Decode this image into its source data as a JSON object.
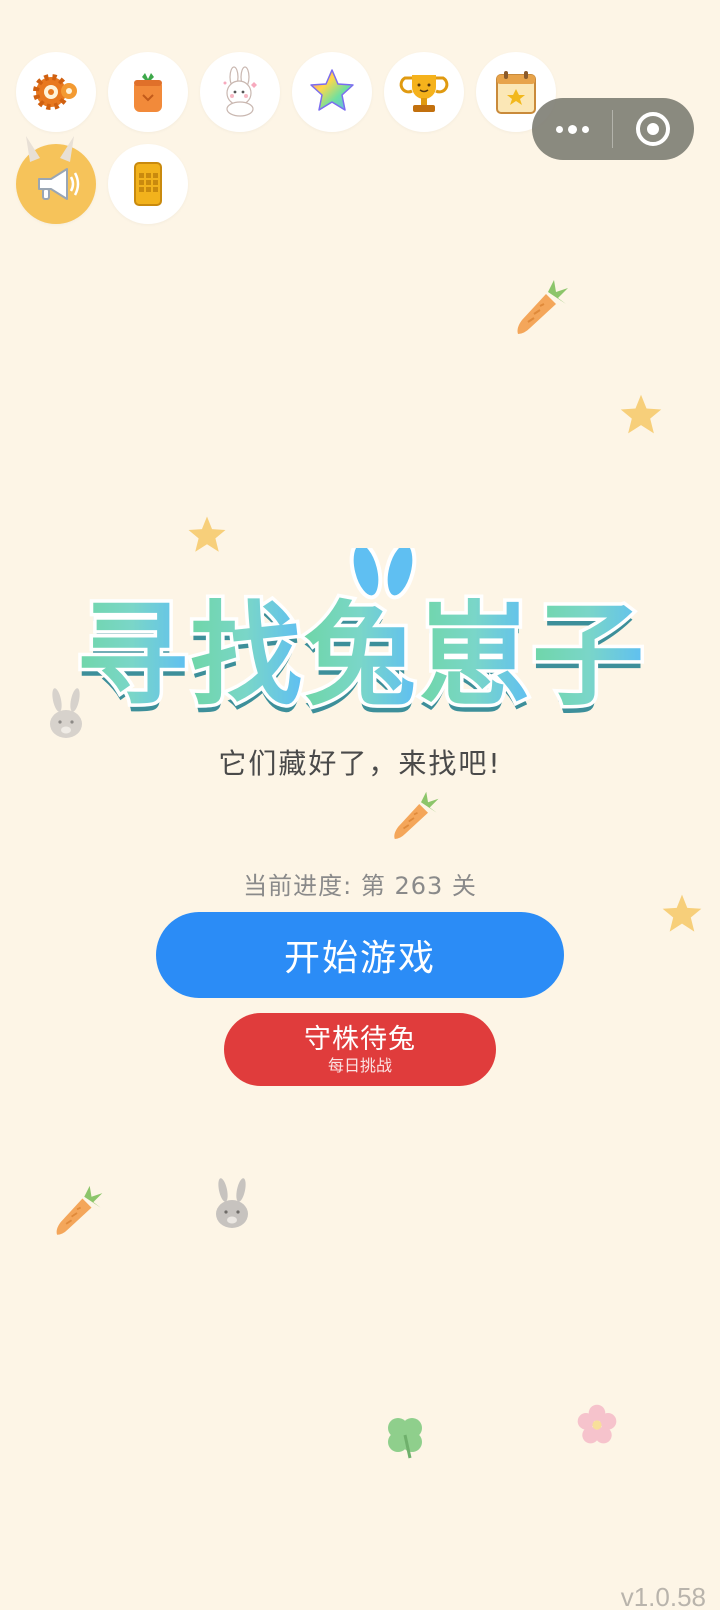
{
  "top_icons": [
    {
      "name": "settings-gear-icon"
    },
    {
      "name": "carrot-bag-icon"
    },
    {
      "name": "bunny-sticker-icon"
    },
    {
      "name": "rainbow-star-icon"
    },
    {
      "name": "trophy-icon"
    },
    {
      "name": "ranking-calendar-icon"
    },
    {
      "name": "megaphone-icon"
    },
    {
      "name": "gold-phone-icon"
    }
  ],
  "capsule": {
    "menu_icon": "more-dots-icon",
    "close_icon": "target-circle-icon"
  },
  "title": {
    "chars": [
      "寻",
      "找",
      "兔",
      "崽",
      "子"
    ]
  },
  "subtitle": "它们藏好了，来找吧!",
  "progress": {
    "text": "当前进度: 第 263 关"
  },
  "buttons": {
    "start_label": "开始游戏",
    "daily_label": "守株待兔",
    "daily_sub": "每日挑战"
  },
  "version": "v1.0.58",
  "colors": {
    "background": "#fdf5e6",
    "start_button": "#2b8cf6",
    "daily_button": "#e03c3c",
    "title_green": "#6fd6a8",
    "title_blue": "#5fbff2"
  }
}
